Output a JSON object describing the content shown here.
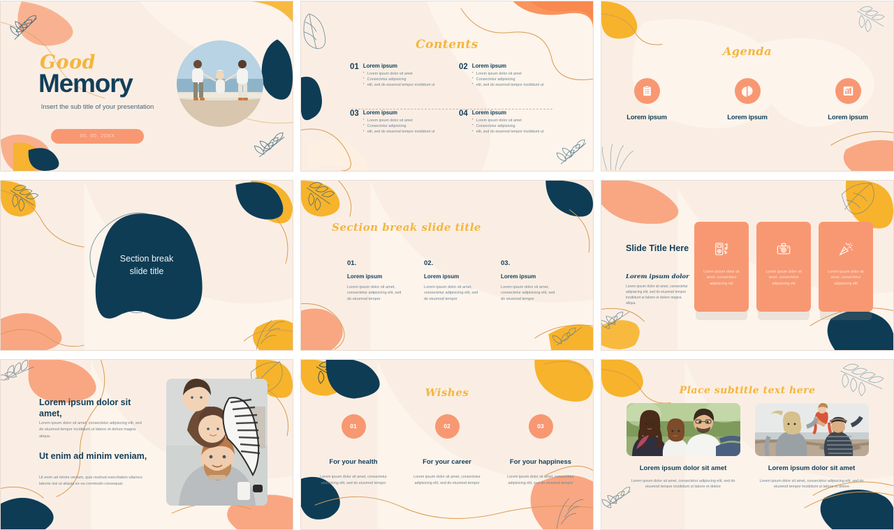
{
  "theme": {
    "bg_cream": "#faeee4",
    "accent_orange": "#f89872",
    "accent_yellow": "#f5b53d",
    "navy": "#123f5a",
    "body_text": "#6c8494"
  },
  "slides": [
    {
      "id": "title-slide",
      "script_title": "Good",
      "main_title": "Memory",
      "subtitle": "Insert the sub title of your presentation",
      "date_badge": "00. 00. 20XX",
      "photo_alt": "family-holding-hands-on-beach"
    },
    {
      "id": "contents-slide",
      "title": "Contents",
      "items": [
        {
          "number": "01",
          "heading": "Lorem ipsum",
          "bullets": [
            "Lorem ipsum dolor sit amet",
            "Consectetur adipisicing",
            "elit, sed do eiusmod tempor incididunt ut"
          ]
        },
        {
          "number": "02",
          "heading": "Lorem ipsum",
          "bullets": [
            "Lorem ipsum dolor sit amet",
            "Consectetur adipisicing",
            "elit, sed do eiusmod tempor incididunt ut"
          ]
        },
        {
          "number": "03",
          "heading": "Lorem ipsum",
          "bullets": [
            "Lorem ipsum dolor sit amet",
            "Consectetur adipisicing",
            "elit, sed do eiusmod tempor incididunt ut"
          ]
        },
        {
          "number": "04",
          "heading": "Lorem ipsum",
          "bullets": [
            "Lorem ipsum dolor sit amet",
            "Consectetur adipisicing",
            "elit, sed do eiusmod tempor incididunt ut"
          ]
        }
      ]
    },
    {
      "id": "agenda-slide",
      "title": "Agenda",
      "items": [
        {
          "icon": "clipboard-checklist-icon",
          "label": "Lorem ipsum"
        },
        {
          "icon": "pie-chart-icon",
          "label": "Lorem ipsum"
        },
        {
          "icon": "bar-chart-icon",
          "label": "Lorem ipsum"
        }
      ]
    },
    {
      "id": "section-break-blob-slide",
      "title_line1": "Section break",
      "title_line2": "slide title"
    },
    {
      "id": "section-break-list-slide",
      "title": "Section break slide title",
      "items": [
        {
          "number": "01.",
          "heading": "Lorem ipsum",
          "body": "Lorem ipsum dolor sit amet, consectetur adipisicing elit, sed do eiusmod tempor"
        },
        {
          "number": "02.",
          "heading": "Lorem ipsum",
          "body": "Lorem ipsum dolor sit amet, consectetur adipisicing elit, sed do eiusmod tempor"
        },
        {
          "number": "03.",
          "heading": "Lorem ipsum",
          "body": "Lorem ipsum dolor sit amet, consectetur adipisicing elit, sed do eiusmod tempor"
        }
      ]
    },
    {
      "id": "cards-slide",
      "title": "Slide Title Here",
      "script_subtitle": "Lorem ipsum dolor",
      "body": "Lorem ipsum dolor sit amet, consectetur adipisicing elit, sed do eiusmod tempor incididunt ut labore et dolore magna aliqua.",
      "cards": [
        {
          "icon": "music-player-icon",
          "text": "Lorem ipsum dolor sit amet, consectetur adipisicing elit"
        },
        {
          "icon": "camera-icon",
          "text": "Lorem ipsum dolor sit amet, consectetur adipisicing elit"
        },
        {
          "icon": "party-popper-icon",
          "text": "Lorem ipsum dolor sit amet, consectetur adipisicing elit"
        }
      ]
    },
    {
      "id": "text-image-slide",
      "heading1": "Lorem ipsum dolor sit amet,",
      "body1": "Lorem ipsum dolor sit amet, consectetur adipiscing elit, sed do eiusmod tempor incididunt ut labore et dolore magna aliqua.",
      "heading2": "Ut enim ad minim veniam,",
      "body2": "Ut enim ad minim veniam, quis nostrud exercitation ullamco laboris nisi ut aliquip ex ea commodo consequat.",
      "photo_alt": "father-with-daughter-on-shoulders"
    },
    {
      "id": "wishes-slide",
      "title": "Wishes",
      "items": [
        {
          "number": "01",
          "heading": "For your health",
          "body": "Lorem ipsum dolor sit amet, consectetur adipisicing elit, sed do eiusmod tempor"
        },
        {
          "number": "02",
          "heading": "For your career",
          "body": "Lorem ipsum dolor sit amet, consectetur adipisicing elit, sed do eiusmod tempor"
        },
        {
          "number": "03",
          "heading": "For your happiness",
          "body": "Lorem ipsum dolor sit amet, consectetur adipisicing elit, sed do eiusmod tempor"
        }
      ]
    },
    {
      "id": "two-photo-slide",
      "title": "Place subtitle text here",
      "items": [
        {
          "photo_alt": "family-sitting-on-grass",
          "heading": "Lorem ipsum dolor sit amet",
          "body": "Lorem ipsum dolor sit amet, consectetur adipiscing elit, sed do eiusmod tempor incididunt ut labore et dolore"
        },
        {
          "photo_alt": "parents-lifting-child-at-beach",
          "heading": "Lorem ipsum dolor sit amet",
          "body": "Lorem ipsum dolor sit amet, consectetur adipiscing elit, sed do eiusmod tempor incididunt ut labore et dolore"
        }
      ]
    }
  ]
}
